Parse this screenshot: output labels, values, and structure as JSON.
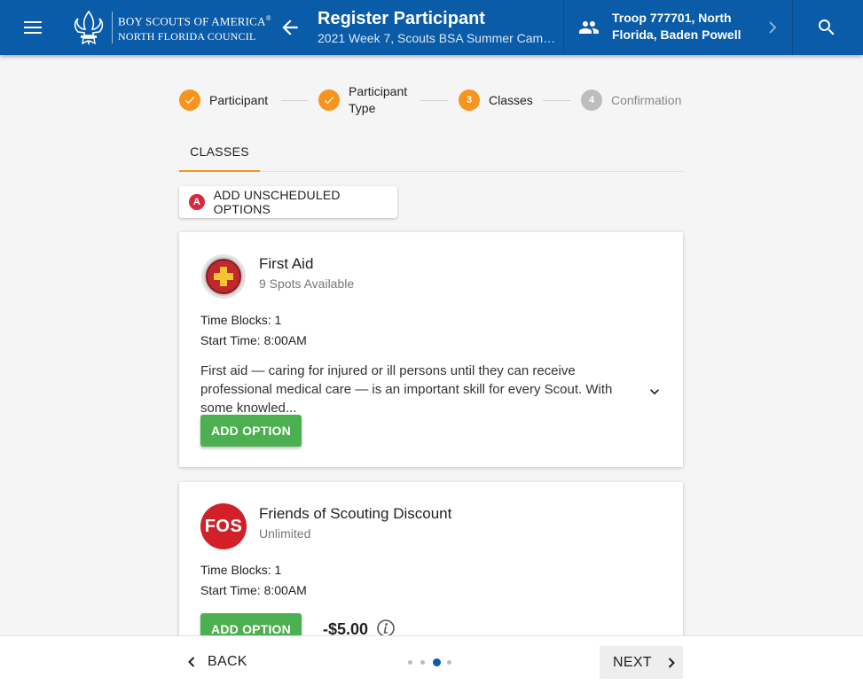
{
  "header": {
    "brand_line1": "BOY SCOUTS OF AMERICA",
    "brand_reg": "®",
    "brand_line2": "NORTH FLORIDA COUNCIL",
    "title": "Register Participant",
    "subtitle": "2021 Week 7, Scouts BSA Summer Camp ...",
    "troop_line1": "Troop 777701, North",
    "troop_line2": "Florida, Baden Powell",
    "colors": {
      "bar": "#0a5ba8",
      "accent": "#f7941e"
    }
  },
  "stepper": {
    "steps": [
      {
        "number": "",
        "label": "Participant",
        "state": "done"
      },
      {
        "number": "",
        "label_line1": "Participant",
        "label_line2": "Type",
        "state": "done"
      },
      {
        "number": "3",
        "label": "Classes",
        "state": "current"
      },
      {
        "number": "4",
        "label": "Confirmation",
        "state": "pending"
      }
    ]
  },
  "tabs": {
    "classes": "CLASSES"
  },
  "unscheduled": {
    "badge": "A",
    "label": "ADD UNSCHEDULED OPTIONS"
  },
  "cards": [
    {
      "title": "First Aid",
      "subtitle": "9 Spots Available",
      "time_blocks": "Time Blocks: 1",
      "start_time": "Start Time: 8:00AM",
      "description": "First aid — caring for injured or ill persons until they can receive professional medical care — is an important skill for every Scout. With some knowled...",
      "button": "ADD OPTION",
      "icon": "first-aid-badge-icon"
    },
    {
      "title": "Friends of Scouting Discount",
      "subtitle": "Unlimited",
      "time_blocks": "Time Blocks: 1",
      "start_time": "Start Time: 8:00AM",
      "button": "ADD OPTION",
      "price": "-$5.00",
      "icon_text": "FOS"
    }
  ],
  "footer": {
    "back": "BACK",
    "next": "NEXT",
    "page_dots": 4,
    "active_dot": 3
  }
}
